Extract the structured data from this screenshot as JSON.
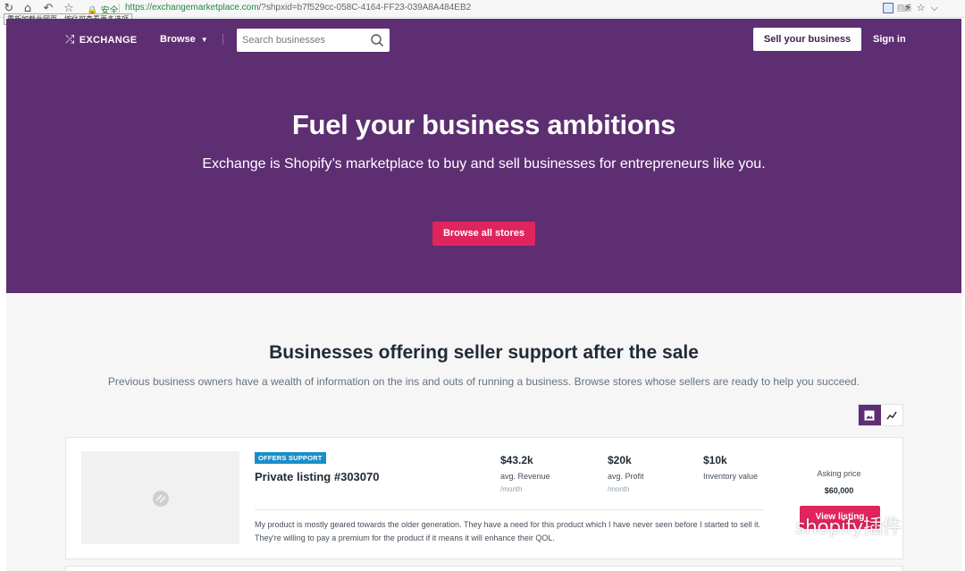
{
  "browser": {
    "secure_label": "安全",
    "url_origin": "https://exchangemarketplace.com",
    "url_rest": "/?shpxid=b7f529cc-058C-4164-FF23-039A8A484EB2",
    "tooltip": "重新加载此网页，按住可查看更多选项",
    "profile_label": "回顾"
  },
  "nav": {
    "logo_text": "EXCHANGE",
    "browse_label": "Browse",
    "search_placeholder": "Search businesses",
    "sell_label": "Sell your business",
    "signin_label": "Sign in"
  },
  "hero": {
    "title": "Fuel your business ambitions",
    "subtitle": "Exchange is Shopify’s marketplace to buy and sell businesses for entrepreneurs like you.",
    "cta_label": "Browse all stores"
  },
  "section": {
    "title": "Businesses offering seller support after the sale",
    "subtitle": "Previous business owners have a wealth of information on the ins and outs of running a business. Browse stores whose sellers are ready to help you succeed."
  },
  "listing": {
    "badge": "OFFERS SUPPORT",
    "title": "Private listing #303070",
    "metrics": [
      {
        "value": "$43.2k",
        "label": "avg. Revenue",
        "period": "/month"
      },
      {
        "value": "$20k",
        "label": "avg. Profit",
        "period": "/month"
      },
      {
        "value": "$10k",
        "label": "Inventory value",
        "period": ""
      }
    ],
    "description": "My product is mostly geared towards the older generation. They have a need for this product which I have never seen before I started to sell it. They're willing to pay a premium for the product if it means it will enhance their QOL.",
    "asking_label": "Asking price",
    "asking_value": "$60,000",
    "view_label": "View listing"
  },
  "watermark": {
    "text": "shopify插件"
  },
  "colors": {
    "brand_purple": "#5e2e72",
    "cta_pink": "#e0245e",
    "badge_blue": "#1a8ec7"
  }
}
